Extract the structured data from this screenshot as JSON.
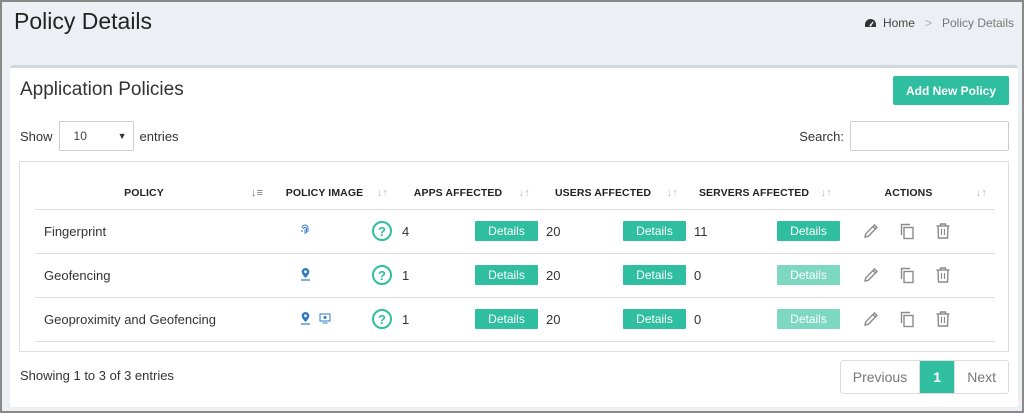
{
  "header": {
    "title": "Policy Details"
  },
  "breadcrumb": {
    "home": "Home",
    "separator": ">",
    "current": "Policy Details"
  },
  "box": {
    "title": "Application Policies",
    "add_button": "Add New Policy"
  },
  "length": {
    "show": "Show",
    "value": "10",
    "entries": "entries"
  },
  "search": {
    "label": "Search:",
    "value": ""
  },
  "table": {
    "headers": [
      "POLICY",
      "POLICY IMAGE",
      "APPS AFFECTED",
      "USERS AFFECTED",
      "SERVERS AFFECTED",
      "ACTIONS"
    ],
    "details_label": "Details",
    "rows": [
      {
        "policy": "Fingerprint",
        "apps": "4",
        "users": "20",
        "servers": "11",
        "servers_enabled": true,
        "images": [
          "fingerprint-icon"
        ]
      },
      {
        "policy": "Geofencing",
        "apps": "1",
        "users": "20",
        "servers": "0",
        "servers_enabled": false,
        "images": [
          "location-pin-icon"
        ]
      },
      {
        "policy": "Geoproximity and Geofencing",
        "apps": "1",
        "users": "20",
        "servers": "0",
        "servers_enabled": false,
        "images": [
          "location-pin-icon",
          "monitor-icon"
        ]
      }
    ]
  },
  "info": "Showing 1 to 3 of 3 entries",
  "pagination": {
    "previous": "Previous",
    "current": "1",
    "next": "Next"
  },
  "colors": {
    "accent": "#2fbe9f",
    "accent_disabled": "#7dd8c2",
    "icon_blue": "#2e7bc4"
  }
}
